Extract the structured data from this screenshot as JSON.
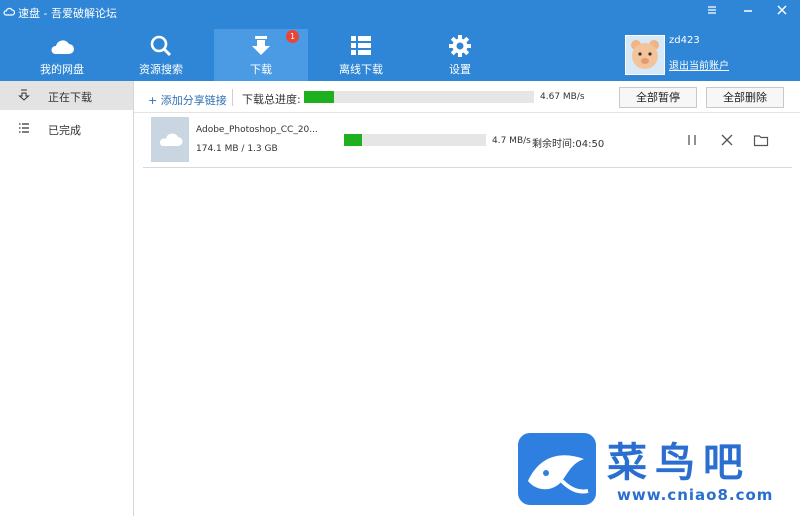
{
  "window": {
    "title": "速盘 - 吾爱破解论坛",
    "menu_icon": "menu-icon",
    "minimize_icon": "minimize-icon",
    "close_icon": "close-icon"
  },
  "nav": {
    "tabs": [
      {
        "label": "我的网盘",
        "icon": "cloud-icon"
      },
      {
        "label": "资源搜索",
        "icon": "search-icon"
      },
      {
        "label": "下载",
        "icon": "download-icon",
        "badge": "1",
        "active": true
      },
      {
        "label": "离线下载",
        "icon": "list-grid-icon"
      },
      {
        "label": "设置",
        "icon": "gear-icon"
      }
    ]
  },
  "user": {
    "name": "zd423",
    "logout_label": "退出当前账户"
  },
  "sidebar": {
    "items": [
      {
        "label": "正在下载",
        "icon": "downloading-icon",
        "active": true
      },
      {
        "label": "已完成",
        "icon": "completed-list-icon"
      }
    ]
  },
  "toolbar": {
    "add_link_label": "+ 添加分享链接",
    "total_progress_label": "下载总进度:",
    "total_progress_fraction": 0.13,
    "total_speed": "4.67 MB/s",
    "pause_all_label": "全部暂停",
    "delete_all_label": "全部删除"
  },
  "tasks": [
    {
      "file_name": "Adobe_Photoshop_CC_20...",
      "size": "174.1 MB / 1.3 GB",
      "progress_fraction": 0.13,
      "speed": "4.7 MB/s",
      "eta": "剩余时间:04:50"
    }
  ],
  "watermark": {
    "name": "菜鸟吧",
    "url": "www.cniao8.com"
  },
  "colors": {
    "header_blue": "#2f86d6",
    "active_tab": "#4a9be3",
    "progress_green": "#1fb01f",
    "badge_red": "#e8443a"
  }
}
